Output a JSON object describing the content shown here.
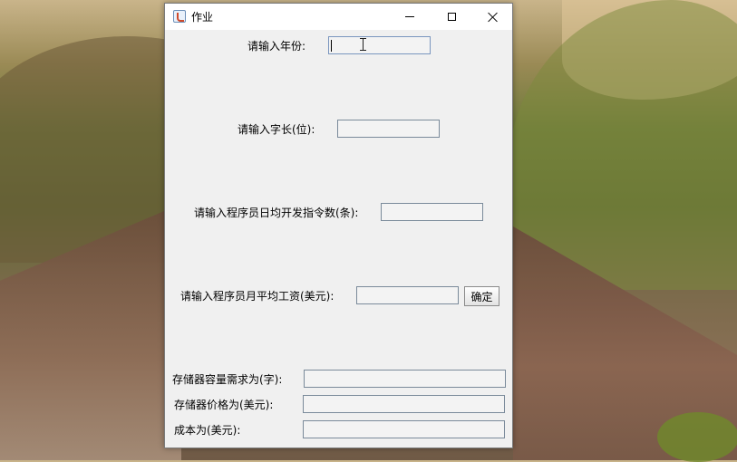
{
  "window": {
    "title": "作业"
  },
  "form": {
    "year_label": "请输入年份:",
    "year_value": "",
    "word_length_label": "请输入字长(位):",
    "word_length_value": "",
    "instructions_label": "请输入程序员日均开发指令数(条):",
    "instructions_value": "",
    "salary_label": "请输入程序员月平均工资(美元):",
    "salary_value": "",
    "confirm_button": "确定"
  },
  "results": {
    "memory_requirement_label": "存储器容量需求为(字):",
    "memory_requirement_value": "",
    "memory_price_label": "存储器价格为(美元):",
    "memory_price_value": "",
    "cost_label": "成本为(美元):",
    "cost_value": ""
  },
  "icons": {
    "app_icon": "java-coffee-icon",
    "minimize": "minimize-icon",
    "maximize": "maximize-icon",
    "close": "close-icon"
  }
}
